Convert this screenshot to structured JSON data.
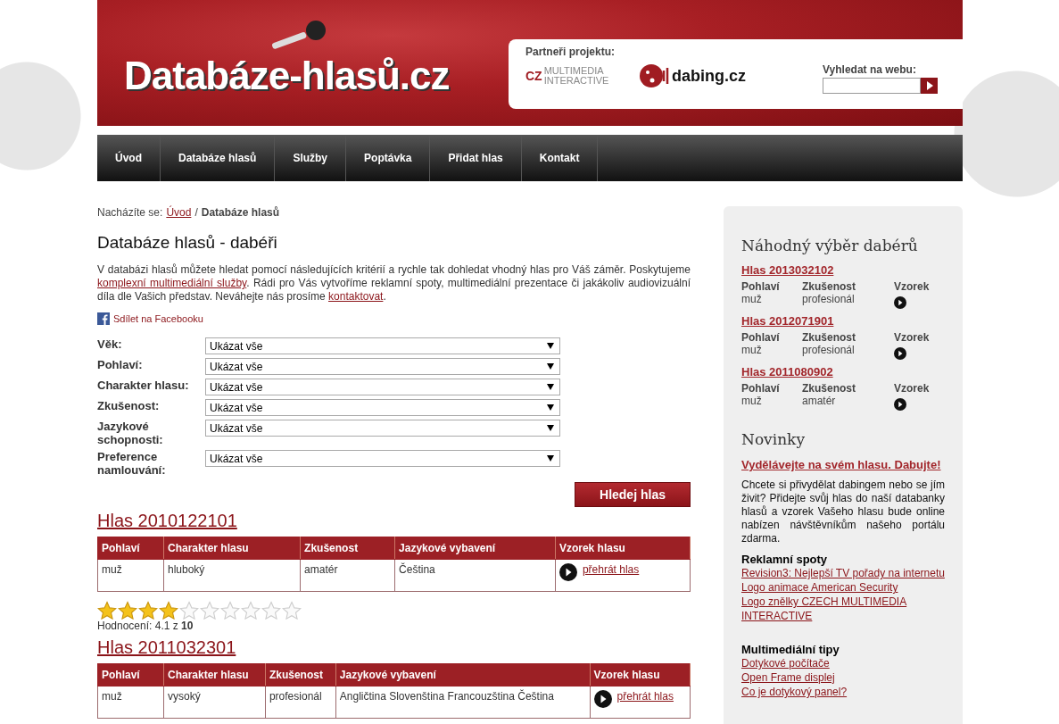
{
  "header": {
    "logo": "Databáze-hlasů.cz",
    "partners_label": "Partneři projektu:",
    "partners": [
      {
        "kind": "cz",
        "text": "CZ",
        "text2": "MULTIMEDIA INTERACTIVE"
      },
      {
        "kind": "dabing",
        "text": "dabing.cz"
      }
    ],
    "search_label": "Vyhledat na webu:"
  },
  "nav": [
    {
      "label": "Úvod",
      "selected": false
    },
    {
      "label": "Databáze hlasů",
      "selected": false
    },
    {
      "label": "Služby",
      "selected": false
    },
    {
      "label": "Poptávka",
      "selected": false
    },
    {
      "label": "Přidat hlas",
      "selected": false
    },
    {
      "label": "Kontakt",
      "selected": false
    }
  ],
  "breadcrumb": {
    "prefix": "Nacházíte se:",
    "home": "Úvod",
    "separator": "/",
    "current": "Databáze hlasů"
  },
  "title": "Databáze hlasů - dabéři",
  "intro": [
    {
      "text": "V databázi hlasů můžete hledat pomocí následujících kritérií a rychle tak dohledat vhodný hlas pro Váš záměr. Poskytujeme "
    },
    {
      "link": "komplexní multimediální služby"
    },
    {
      "text": ". Rádi pro Vás vytvoříme reklamní spoty, multimediální prezentace či jakákoliv audiovizuální díla dle Vašich představ. Neváhejte nás prosíme "
    },
    {
      "link": "kontaktovat"
    },
    {
      "text": "."
    }
  ],
  "share": "Sdílet na Facebooku",
  "filters": [
    {
      "label": "Věk:",
      "value": "Ukázat vše"
    },
    {
      "label": "Pohlaví:",
      "value": "Ukázat vše"
    },
    {
      "label": "Charakter hlasu:",
      "value": "Ukázat vše"
    },
    {
      "label": "Zkušenost:",
      "value": "Ukázat vše"
    },
    {
      "label": "Jazykové schopnosti:",
      "value": "Ukázat vše"
    },
    {
      "label": "Preference namlouvání:",
      "value": "Ukázat vše"
    }
  ],
  "search_button": "Hledej hlas",
  "results": [
    {
      "title": "Hlas 2010122101",
      "columns": [
        "Pohlaví",
        "Charakter hlasu",
        "Zkušenost",
        "Jazykové vybavení",
        "Vzorek hlasu"
      ],
      "cells": [
        "muž",
        "hluboký",
        "amatér",
        "Čeština"
      ],
      "play": "přehrát hlas",
      "stars": 4,
      "rating_prefix": "Hodnocení: 4.1 z",
      "rating_max": "10"
    },
    {
      "title": "Hlas 2011032301",
      "columns": [
        "Pohlaví",
        "Charakter hlasu",
        "Zkušenost",
        "Jazykové vybavení",
        "Vzorek hlasu"
      ],
      "cells": [
        "muž",
        "vysoký",
        "profesionál",
        "Angličtina Slovenština Francouzština Čeština"
      ],
      "play": "přehrát hlas"
    }
  ],
  "sidebar": {
    "random_title": "Náhodný výběr dabérů",
    "random": [
      {
        "title": "Hlas 2013032102",
        "labels": [
          "Pohlaví",
          "Zkušenost",
          "Vzorek"
        ],
        "values": [
          "muž",
          "profesionál"
        ]
      },
      {
        "title": "Hlas 2012071901",
        "labels": [
          "Pohlaví",
          "Zkušenost",
          "Vzorek"
        ],
        "values": [
          "muž",
          "profesionál"
        ]
      },
      {
        "title": "Hlas 2011080902",
        "labels": [
          "Pohlaví",
          "Zkušenost",
          "Vzorek"
        ],
        "values": [
          "muž",
          "amatér"
        ]
      }
    ],
    "news_title": "Novinky",
    "news_link": "Vydělávejte na svém hlasu. Dabujte!",
    "news_text": "Chcete si přivydělat dabingem nebo se jím živit? Přidejte svůj hlas do naší databanky hlasů a vzorek Vašeho hlasu bude online nabízen návštěvníkům našeho portálu zdarma.",
    "lists": [
      {
        "title": "Reklamní spoty",
        "links": [
          "Revision3: Nejlepší TV pořady na internetu",
          "Logo animace American Security",
          "Logo znělky CZECH MULTIMEDIA INTERACTIVE"
        ]
      },
      {
        "title": "Multimediální tipy",
        "links": [
          "Dotykové počítače",
          "Open Frame displej",
          "Co je dotykový panel?"
        ]
      }
    ]
  }
}
